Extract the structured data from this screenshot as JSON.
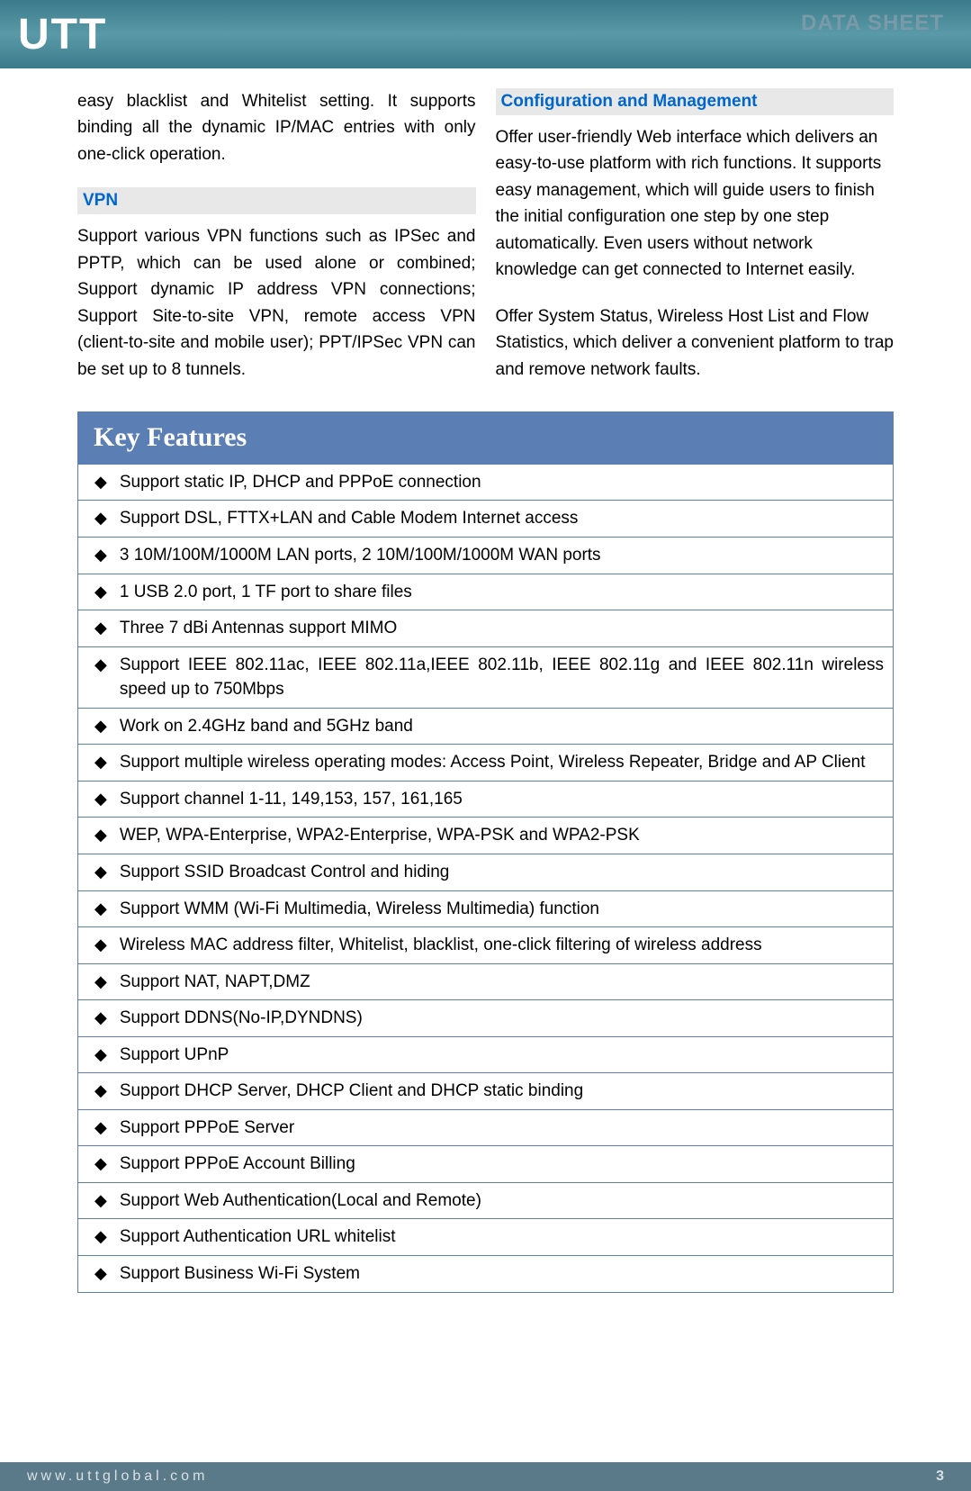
{
  "header": {
    "logo": "UTT",
    "data_sheet": "DATA SHEET"
  },
  "col_left": {
    "intro": "easy blacklist and Whitelist setting. It supports binding all the dynamic IP/MAC entries with only one-click operation.",
    "vpn_heading": "VPN",
    "vpn_body": "Support various VPN functions such as IPSec and PPTP, which can be used alone or combined; Support dynamic IP address VPN connections; Support Site-to-site VPN, remote access VPN (client-to-site and mobile user); PPT/IPSec VPN can be set up to 8 tunnels."
  },
  "col_right": {
    "config_heading": "Configuration and Management",
    "config_body1": "Offer user-friendly Web interface which delivers an easy-to-use platform with rich functions. It supports easy management, which will guide users to finish the initial configuration one step by one step automatically. Even users without network knowledge can get connected to Internet easily.",
    "config_body2": "Offer System Status, Wireless Host List and Flow Statistics, which deliver a convenient platform to trap and remove network faults."
  },
  "key_features_title": "Key Features",
  "features": [
    "Support static IP, DHCP and PPPoE connection",
    "Support DSL, FTTX+LAN and Cable Modem Internet access",
    "3 10M/100M/1000M LAN ports, 2 10M/100M/1000M WAN ports",
    "1 USB 2.0 port, 1 TF port to share files",
    "Three 7 dBi Antennas support MIMO",
    "Support IEEE 802.11ac, IEEE 802.11a,IEEE 802.11b, IEEE 802.11g and IEEE 802.11n wireless speed up to 750Mbps",
    "Work on 2.4GHz band and 5GHz band",
    "Support multiple wireless operating modes: Access Point, Wireless Repeater, Bridge and AP Client",
    "Support channel 1-11, 149,153, 157, 161,165",
    "WEP, WPA-Enterprise, WPA2-Enterprise, WPA-PSK and WPA2-PSK",
    "Support SSID Broadcast Control and hiding",
    "Support WMM (Wi-Fi Multimedia, Wireless Multimedia) function",
    "Wireless MAC address filter, Whitelist, blacklist, one-click filtering of wireless address",
    "Support NAT, NAPT,DMZ",
    "Support DDNS(No-IP,DYNDNS)",
    "Support UPnP",
    "Support DHCP Server, DHCP Client and DHCP static binding",
    "Support PPPoE Server",
    "Support PPPoE Account Billing",
    "Support Web Authentication(Local and Remote)",
    "Support Authentication URL whitelist",
    "Support Business Wi-Fi System"
  ],
  "footer": {
    "url": "www.uttglobal.com",
    "page": "3"
  }
}
